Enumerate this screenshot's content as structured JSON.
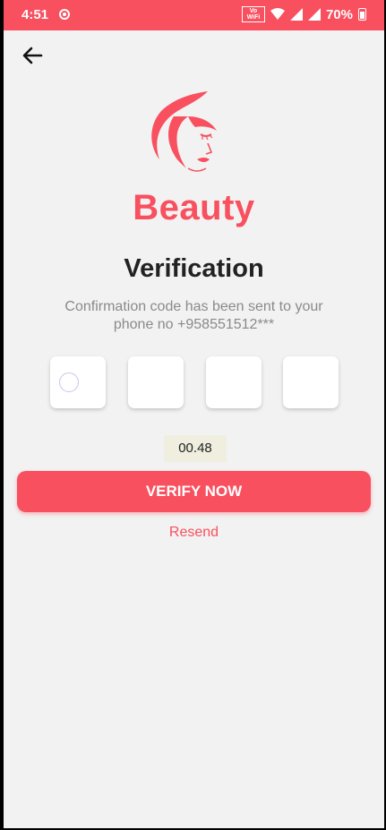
{
  "status_bar": {
    "time": "4:51",
    "vowifi": "Vo WiFi",
    "battery": "70%"
  },
  "brand": {
    "name": "Beauty",
    "color": "#f8505f"
  },
  "verification": {
    "title": "Verification",
    "message": "Confirmation code has been sent to your phone no +958551512***",
    "code_digits": [
      "",
      "",
      "",
      ""
    ],
    "timer": "00.48",
    "verify_button": "VERIFY NOW",
    "resend_link": "Resend"
  }
}
